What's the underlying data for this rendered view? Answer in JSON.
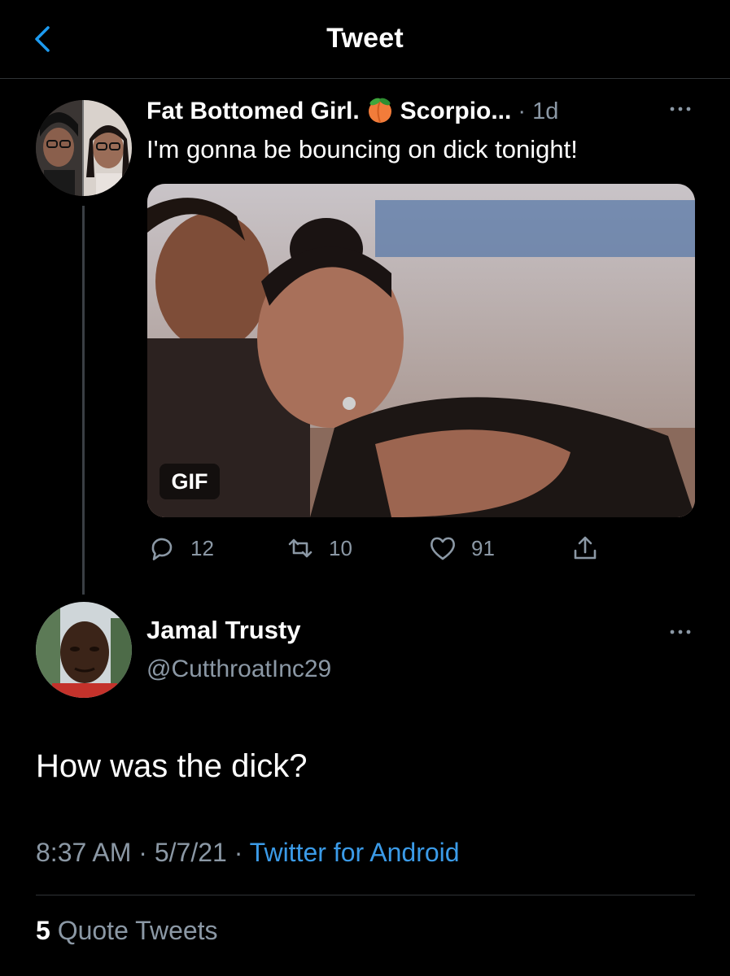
{
  "header": {
    "title": "Tweet",
    "back_icon": "chevron-left-icon"
  },
  "parent_tweet": {
    "display_name_start": "Fat Bottomed Girl.",
    "emoji": "peach",
    "display_name_end": "Scorpio...",
    "time_sep": " · ",
    "time": "1d",
    "text": "I'm gonna be bouncing on dick tonight!",
    "media_badge": "GIF",
    "counts": {
      "replies": "12",
      "retweets": "10",
      "likes": "91"
    }
  },
  "main_tweet": {
    "display_name": "Jamal Trusty",
    "handle": "@CutthroatInc29",
    "text": "How was the dick?",
    "time": "8:37 AM",
    "sep": " · ",
    "date": "5/7/21",
    "source": "Twitter for Android",
    "quote_count": "5",
    "quote_label": " Quote Tweets"
  },
  "colors": {
    "background": "#000000",
    "secondary_text": "#8b98a5",
    "link": "#3b9be8",
    "divider": "#2f3336"
  }
}
